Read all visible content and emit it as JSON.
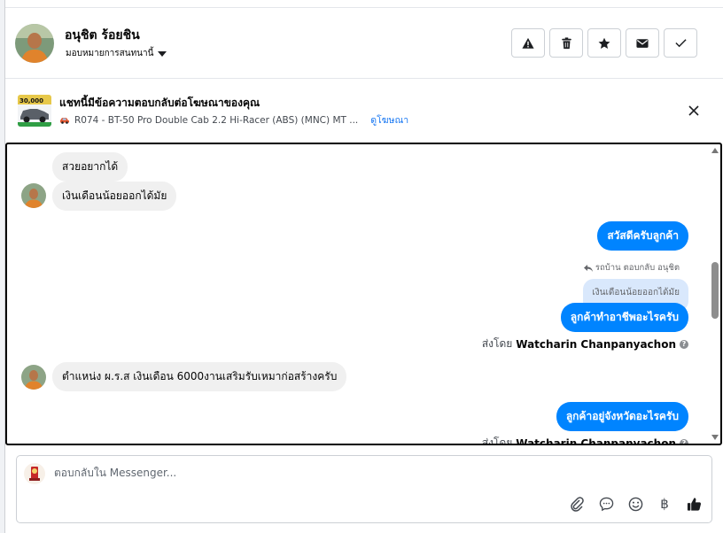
{
  "colors": {
    "accent": "#0084ff",
    "link": "#1877f2",
    "incoming_bubble": "#f0f0f0",
    "quoted_bubble": "#d9e8fc"
  },
  "header": {
    "name": "อนุชิต ร้อยชิน",
    "assign_label": "มอบหมายการสนทนานี้",
    "actions": [
      {
        "icon": "warning-icon"
      },
      {
        "icon": "trash-icon"
      },
      {
        "icon": "star-icon"
      },
      {
        "icon": "mail-icon"
      },
      {
        "icon": "check-icon"
      }
    ]
  },
  "ad": {
    "title": "แชทนี้มีข้อความตอบกลับต่อโฆษณาของคุณ",
    "product": "R074 - BT-50 Pro Double Cab 2.2 Hi-Racer (ABS) (MNC) MT ...",
    "view_ad_link": "ดูโฆษณา",
    "thumb_price": "30,000"
  },
  "messages": {
    "m1": "สวยอยากได้",
    "m2": "เงินเดือนน้อยออกได้มัย",
    "m3": "สวัสดีครับลูกค้า",
    "reply_meta": "รถบ้าน ตอบกลับ อนุชิต",
    "quoted": "เงินเดือนน้อยออกได้มัย",
    "m4": "ลูกค้าทำอาชีพอะไรครับ",
    "sent_by_label": "ส่งโดย",
    "sender": "Watcharin Chanpanyachon",
    "m5": "ตำแหน่ง ผ.ร.ส เงินเดือน 6000งานเสริมรับเหมาก่อสร้างครับ",
    "m6": "ลูกค้าอยู่จังหวัดอะไรครับ"
  },
  "composer": {
    "placeholder": "ตอบกลับใน Messenger...",
    "tools": [
      "attachment-icon",
      "chat-bubble-icon",
      "emoji-icon",
      "baht-icon",
      "thumbs-up-icon"
    ],
    "baht_symbol": "฿"
  }
}
